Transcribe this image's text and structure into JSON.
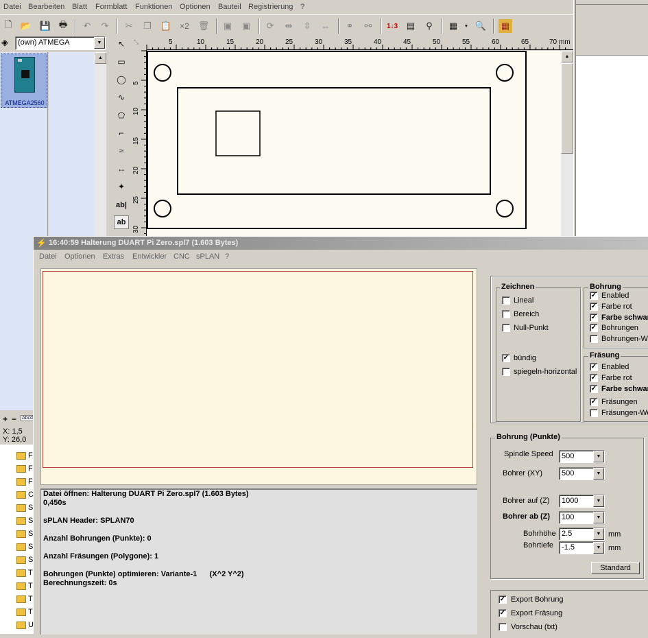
{
  "main_menu": [
    "Datei",
    "Bearbeiten",
    "Blatt",
    "Formblatt",
    "Funktionen",
    "Optionen",
    "Bauteil",
    "Registrierung",
    "?"
  ],
  "layer_select": "(own) ATMEGA",
  "component": {
    "label": "ATMEGA2560"
  },
  "coords": {
    "x": "X: 1,5",
    "y": "Y: 26,0"
  },
  "zoom_controls": {
    "plus": "+",
    "minus": "−",
    "abc": "Abcd"
  },
  "ruler": {
    "unit": "mm",
    "h_ticks": [
      "5",
      "10",
      "15",
      "20",
      "25",
      "30",
      "35",
      "40",
      "45",
      "50",
      "55",
      "60",
      "65",
      "70"
    ],
    "v_ticks": [
      "5",
      "10",
      "15",
      "20",
      "25",
      "30"
    ]
  },
  "tools": {
    "text1": "ab|",
    "text2": "ab"
  },
  "dialog": {
    "title": "16:40:59  Halterung DUART Pi Zero.spl7   (1.603 Bytes)",
    "menu": [
      "Datei",
      "Optionen",
      "Extras",
      "Entwickler",
      "CNC",
      "sPLAN",
      "?"
    ],
    "log": [
      "Datei öffnen: Halterung DUART Pi Zero.spl7   (1.603 Bytes)",
      "0,450s",
      "",
      "sPLAN Header: SPLAN70",
      "",
      "Anzahl Bohrungen (Punkte): 0",
      "",
      "Anzahl Fräsungen (Polygone): 1",
      "",
      "Bohrungen (Punkte) optimieren: Variante-1      (X^2 Y^2)",
      "Berechnungszeit: 0s"
    ],
    "zeichnen": {
      "title": "Zeichnen",
      "items": [
        {
          "label": "Lineal",
          "checked": false
        },
        {
          "label": "Bereich",
          "checked": false
        },
        {
          "label": "Null-Punkt",
          "checked": false
        },
        {
          "label": "bündig",
          "checked": true
        },
        {
          "label": "spiegeln-horizontal",
          "checked": false
        }
      ]
    },
    "bohrung": {
      "title": "Bohrung",
      "items": [
        {
          "label": "Enabled",
          "checked": true
        },
        {
          "label": "Farbe rot",
          "checked": true
        },
        {
          "label": "Farbe schwarz",
          "checked": true
        },
        {
          "label": "Bohrungen",
          "checked": true
        },
        {
          "label": "Bohrungen-Werte",
          "checked": false
        }
      ]
    },
    "fraesung": {
      "title": "Fräsung",
      "items": [
        {
          "label": "Enabled",
          "checked": true
        },
        {
          "label": "Farbe rot",
          "checked": true
        },
        {
          "label": "Farbe schwarz",
          "checked": true
        },
        {
          "label": "Fräsungen",
          "checked": true
        },
        {
          "label": "Fräsungen-Werte",
          "checked": false
        }
      ]
    },
    "punkte": {
      "title": "Bohrung (Punkte)",
      "spindle_label": "Spindle Speed",
      "spindle": "500",
      "bohrer_xy_label": "Bohrer (XY)",
      "bohrer_xy": "500",
      "auf_label": "Bohrer auf (Z)",
      "auf": "1000",
      "ab_label": "Bohrer ab (Z)",
      "ab": "100",
      "hoehe_label": "Bohrhöhe",
      "hoehe": "2.5",
      "tiefe_label": "Bohrtiefe",
      "tiefe": "-1.5",
      "unit": "mm",
      "standard": "Standard"
    },
    "export": [
      {
        "label": "Export Bohrung",
        "checked": true
      },
      {
        "label": "Export Fräsung",
        "checked": true
      },
      {
        "label": "Vorschau (txt)",
        "checked": false
      }
    ]
  },
  "folder_letters": [
    "F",
    "F",
    "F",
    "C",
    "S",
    "S",
    "S",
    "S",
    "S",
    "T",
    "T",
    "T",
    "T",
    "U"
  ]
}
